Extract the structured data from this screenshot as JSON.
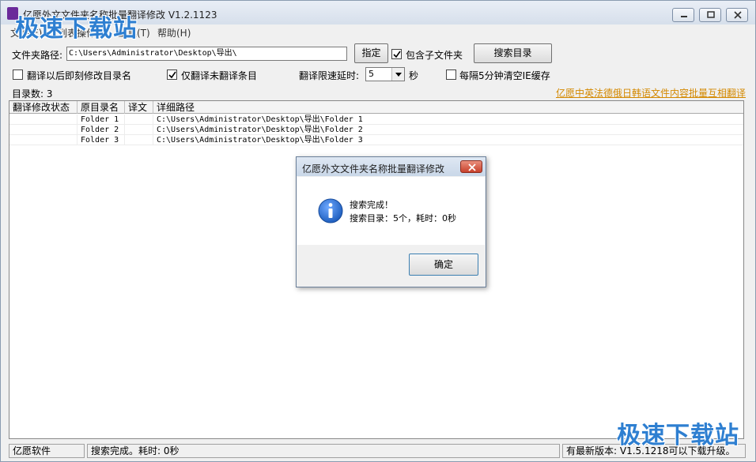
{
  "window": {
    "title": "亿愿外文文件夹名称批量翻译修改 V1.2.1123"
  },
  "watermark": {
    "text": "极速下载站"
  },
  "menu": [
    "文件(F)",
    "列表操作(L)",
    "工具(T)",
    "帮助(H)"
  ],
  "toolbar": {
    "path_label": "文件夹路径:",
    "path_value": "C:\\Users\\Administrator\\Desktop\\导出\\",
    "specify_button": "指定",
    "include_subfolders_label": "包含子文件夹",
    "include_subfolders_checked": true,
    "search_button": "搜索目录"
  },
  "options": {
    "rename_after_translate_label": "翻译以后即刻修改目录名",
    "rename_after_translate_checked": false,
    "only_untranslated_label": "仅翻译未翻译条目",
    "only_untranslated_checked": true,
    "delay_label": "翻译限速延时:",
    "delay_value": "5",
    "delay_unit": "秒",
    "clear_cache_label": "每隔5分钟清空IE缓存",
    "clear_cache_checked": false
  },
  "count_label": "目录数: 3",
  "promo_link": "亿愿中英法德俄日韩语文件内容批量互相翻译",
  "table": {
    "columns": [
      "翻译修改状态",
      "原目录名",
      "译文",
      "详细路径"
    ],
    "rows": [
      {
        "status": "",
        "name": "Folder 1",
        "translation": "",
        "path": "C:\\Users\\Administrator\\Desktop\\导出\\Folder 1"
      },
      {
        "status": "",
        "name": "Folder 2",
        "translation": "",
        "path": "C:\\Users\\Administrator\\Desktop\\导出\\Folder 2"
      },
      {
        "status": "",
        "name": "Folder 3",
        "translation": "",
        "path": "C:\\Users\\Administrator\\Desktop\\导出\\Folder 3"
      }
    ]
  },
  "dialog": {
    "title": "亿愿外文文件夹名称批量翻译修改",
    "line1": "搜索完成！",
    "line2": "搜索目录：5个，耗时：0秒",
    "ok_button": "确定"
  },
  "statusbar": {
    "company": "亿愿软件",
    "status": "搜索完成。耗时: 0秒",
    "update": "有最新版本: V1.5.1218可以下载升级。"
  },
  "colors": {
    "link": "#d48900",
    "watermark": "#2e7fd1",
    "info_icon": "#1f5fbf"
  }
}
